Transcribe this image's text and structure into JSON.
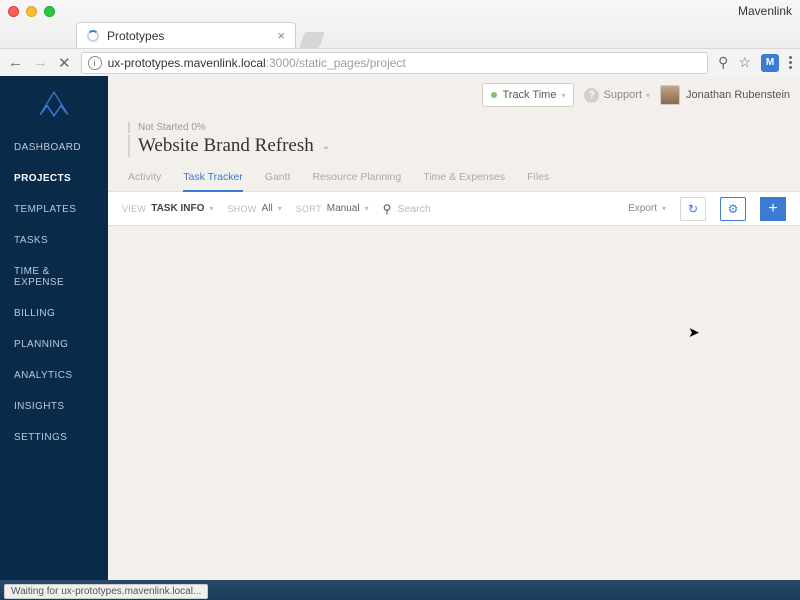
{
  "browser": {
    "brand": "Mavenlink",
    "tab_title": "Prototypes",
    "url_host": "ux-prototypes.mavenlink.local",
    "url_port_path": ":3000/static_pages/project",
    "status_text": "Waiting for ux-prototypes.mavenlink.local..."
  },
  "topbar": {
    "track_time": "Track Time",
    "support": "Support",
    "user_name": "Jonathan Rubenstein"
  },
  "sidebar": {
    "items": [
      {
        "label": "DASHBOARD"
      },
      {
        "label": "PROJECTS"
      },
      {
        "label": "TEMPLATES"
      },
      {
        "label": "TASKS"
      },
      {
        "label": "TIME & EXPENSE"
      },
      {
        "label": "BILLING"
      },
      {
        "label": "PLANNING"
      },
      {
        "label": "ANALYTICS"
      },
      {
        "label": "INSIGHTS"
      },
      {
        "label": "SETTINGS"
      }
    ],
    "active_index": 1
  },
  "project": {
    "status": "Not Started 0%",
    "title": "Website Brand Refresh"
  },
  "subtabs": {
    "items": [
      {
        "label": "Activity"
      },
      {
        "label": "Task Tracker"
      },
      {
        "label": "Gantt"
      },
      {
        "label": "Resource Planning"
      },
      {
        "label": "Time & Expenses"
      },
      {
        "label": "Files"
      }
    ],
    "active_index": 1
  },
  "filters": {
    "view_label": "VIEW",
    "view_value": "TASK INFO",
    "show_label": "SHOW",
    "show_value": "All",
    "sort_label": "SORT",
    "sort_value": "Manual",
    "search_placeholder": "Search",
    "export_label": "Export"
  }
}
